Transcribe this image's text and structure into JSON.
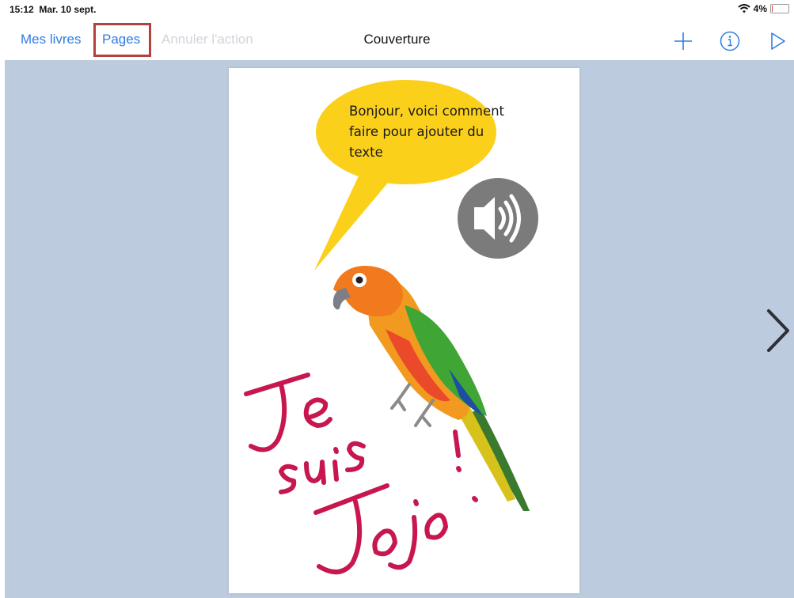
{
  "status": {
    "time": "15:12",
    "date": "Mar. 10 sept.",
    "battery_percent": "4%",
    "battery_level": 0.04,
    "wifi_icon": "wifi-icon"
  },
  "toolbar": {
    "back_label": "Mes livres",
    "pages_label": "Pages",
    "undo_label": "Annuler l'action",
    "title": "Couverture",
    "add_icon": "plus-icon",
    "info_icon": "info-icon",
    "play_icon": "play-icon",
    "accent_color": "#2f7de1",
    "highlight_color": "#b2413e"
  },
  "page": {
    "bubble_lines": [
      "Bonjour, voici comment",
      "faire pour ajouter du",
      "texte"
    ],
    "bubble_color": "#fbd01b",
    "sound_icon": "speaker-icon",
    "handwriting": [
      "Je",
      "suis",
      "Jojo.",
      "!"
    ],
    "handwriting_color": "#c8174f",
    "image": "parrot"
  },
  "navigation": {
    "next_icon": "chevron-right-icon"
  },
  "colors": {
    "background": "#bccbdd"
  }
}
